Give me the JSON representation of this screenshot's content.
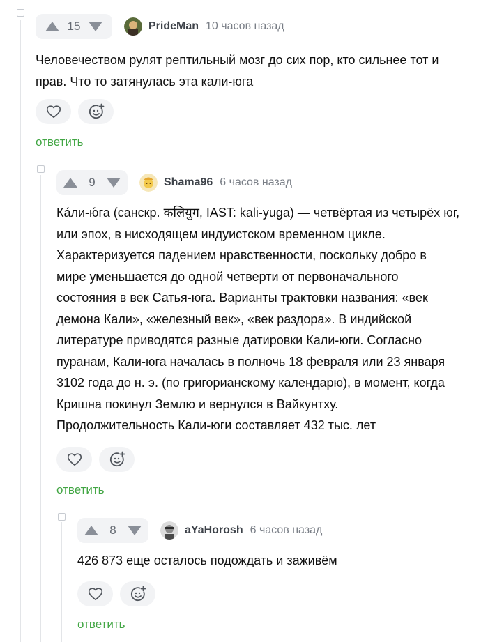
{
  "comments": [
    {
      "score": "15",
      "author": "PrideMan",
      "time": "10 часов назад",
      "lines": [
        "Человечеством рулят рептильный мозг до сих пор, кто сильнее тот и",
        "прав. Что то затянулась эта кали-юга"
      ],
      "reply_label": "ответить"
    },
    {
      "score": "9",
      "author": "Shama96",
      "time": "6 часов назад",
      "lines": [
        "Ка́ли-ю́га (санскр. कलियुग, IAST: kali-yuga) — четвёртая из четырёх юг,",
        "или эпох, в нисходящем индуистском временном цикле.",
        "Характеризуется падением нравственности, поскольку добро в",
        "мире уменьшается до одной четверти от первоначального",
        "состояния в век Сатья-юга. Варианты трактовки названия: «век",
        "демона Кали», «железный век», «век раздора». В индийской",
        "литературе приводятся разные датировки Кали-юги. Согласно",
        "пуранам, Кали-юга началась в полночь 18 февраля или 23 января",
        "3102 года до н. э. (по григорианскому календарю), в момент, когда",
        "Кришна покинул Землю и вернулся в Вайкунтху.",
        "Продолжительность Кали-юги составляет 432 тыс. лет"
      ],
      "reply_label": "ответить"
    },
    {
      "score": "8",
      "author": "aYaHorosh",
      "time": "6 часов назад",
      "lines": [
        "426 873 еще осталось подождать и заживём"
      ],
      "reply_label": "ответить"
    }
  ]
}
